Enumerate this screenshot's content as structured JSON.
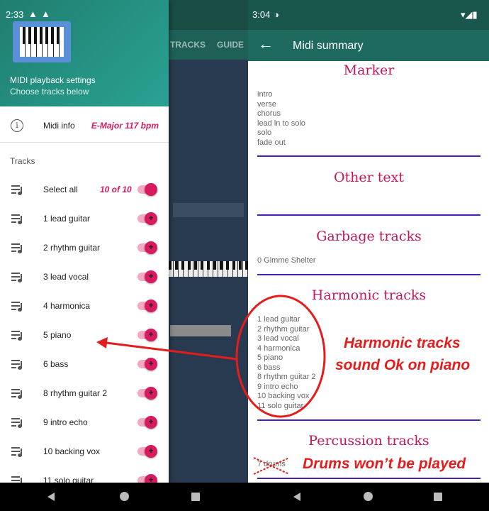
{
  "left": {
    "status_time": "2:33",
    "bg_tabs": [
      "TRACKS",
      "GUIDE"
    ],
    "drawer_title": "MIDI playback settings",
    "drawer_subtitle": "Choose tracks below",
    "midi_info_label": "Midi info",
    "midi_info_value": "E-Major 117 bpm",
    "tracks_header": "Tracks",
    "select_all_label": "Select all",
    "select_all_count": "10 of 10",
    "tracks": [
      "1 lead guitar",
      "2 rhythm guitar",
      "3 lead vocal",
      "4 harmonica",
      "5 piano",
      "6 bass",
      "8 rhythm guitar 2",
      "9 intro echo",
      "10 backing vox",
      "11 solo guitar"
    ]
  },
  "right": {
    "status_time": "3:04",
    "title": "Midi summary",
    "marker_title": "Marker",
    "marker_items": [
      "intro",
      "verse",
      "chorus",
      "lead in to solo",
      "solo",
      "fade out"
    ],
    "other_text_title": "Other text",
    "garbage_title": "Garbage tracks",
    "garbage_items": [
      "0 Gimme Shelter"
    ],
    "harmonic_title": "Harmonic tracks",
    "harmonic_items": [
      "1 lead guitar",
      "2 rhythm guitar",
      "3 lead vocal",
      "4 harmonica",
      "5 piano",
      "6 bass",
      "8 rhythm guitar 2",
      "9 intro echo",
      "10 backing vox",
      "11 solo guitar"
    ],
    "percussion_title": "Percussion tracks",
    "percussion_items": [
      "7 drums"
    ]
  },
  "annotations": {
    "harmonic_note_line1": "Harmonic tracks",
    "harmonic_note_line2": "sound Ok on piano",
    "drums_note": "Drums won’t be played",
    "color": "#e41c1c"
  },
  "colors": {
    "accent": "#d81b60",
    "header_teal": "#1e6a5e",
    "section_title": "#c2185b",
    "divider": "#4a1fb8"
  }
}
